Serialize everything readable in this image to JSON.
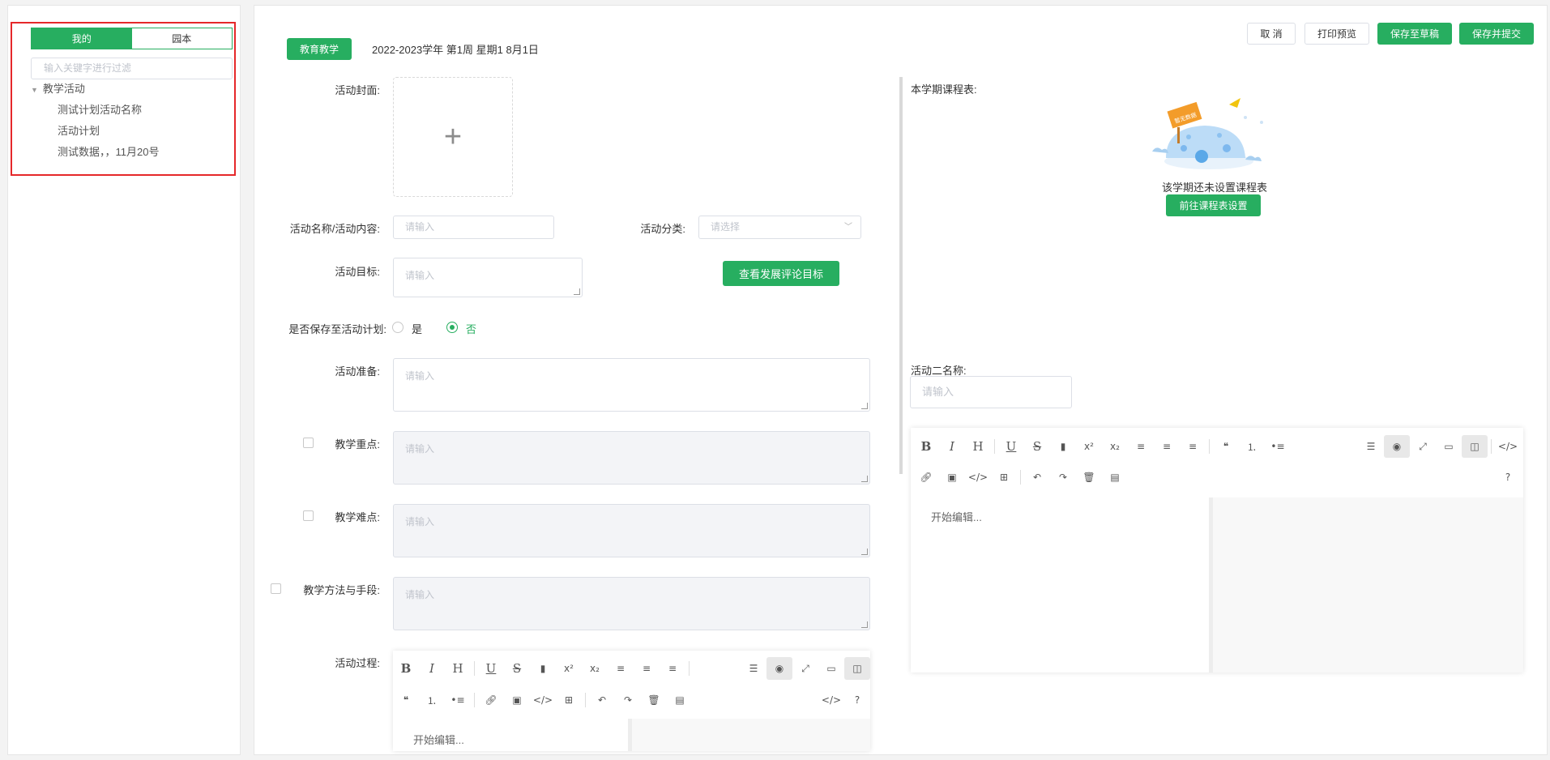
{
  "left": {
    "tabs": [
      "我的",
      "园本"
    ],
    "filter_placeholder": "输入关键字进行过滤",
    "tree": {
      "root": "教学活动",
      "children": [
        "测试计划活动名称",
        "活动计划",
        "测试数据，，11月20号"
      ]
    }
  },
  "header": {
    "badge": "教育教学",
    "date": "2022-2023学年 第1周 星期1 8月1日",
    "buttons": [
      "取 消",
      "打印预览",
      "保存至草稿",
      "保存并提交"
    ]
  },
  "form": {
    "cover_label": "活动封面:",
    "name_label": "活动名称/活动内容:",
    "name_placeholder": "请输入",
    "category_label": "活动分类:",
    "category_placeholder": "请选择",
    "goal_label": "活动目标:",
    "goal_placeholder": "请输入",
    "view_goals_button": "查看发展评论目标",
    "save_plan_label": "是否保存至活动计划:",
    "radio_yes": "是",
    "radio_no": "否",
    "prep_label": "活动准备:",
    "prep_placeholder": "请输入",
    "focus_label": "教学重点:",
    "focus_placeholder": "请输入",
    "difficulty_label": "教学难点:",
    "difficulty_placeholder": "请输入",
    "method_label": "教学方法与手段:",
    "method_placeholder": "请输入",
    "process_label": "活动过程:",
    "process_editor_placeholder": "开始编辑..."
  },
  "right": {
    "schedule_label": "本学期课程表:",
    "illustration_sign": "暂无数据",
    "empty_text": "该学期还未设置课程表",
    "goto_button": "前往课程表设置",
    "activity2_label": "活动二名称:",
    "activity2_placeholder": "请输入",
    "editor_placeholder": "开始编辑..."
  },
  "colors": {
    "primary": "#27ae60",
    "highlight": "#e5282a"
  }
}
